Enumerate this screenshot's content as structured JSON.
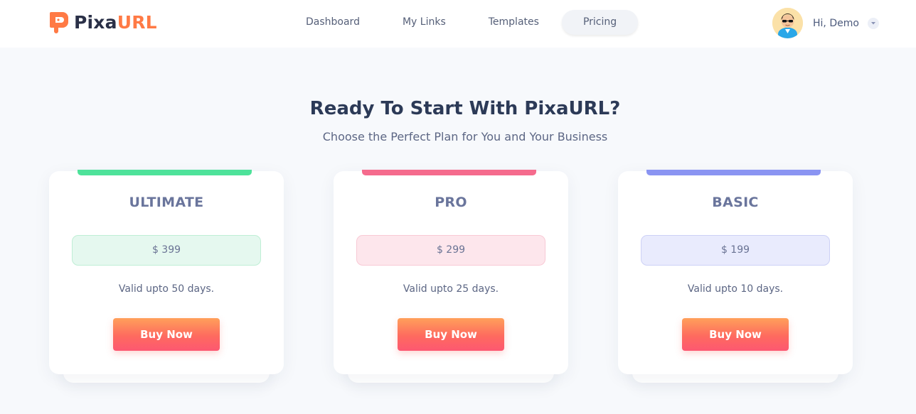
{
  "brand": {
    "name_part1": "Pixa",
    "name_part2": "URL",
    "accent_color": "#ff7a45"
  },
  "nav": {
    "items": [
      {
        "label": "Dashboard",
        "active": false
      },
      {
        "label": "My Links",
        "active": false
      },
      {
        "label": "Templates",
        "active": false
      },
      {
        "label": "Pricing",
        "active": true
      }
    ]
  },
  "user": {
    "greeting": "Hi, Demo",
    "avatar_icon": "avatar-icon",
    "menu_icon": "caret-down-icon"
  },
  "hero": {
    "title": "Ready To Start With PixaURL?",
    "subtitle": "Choose the Perfect Plan for You and Your Business"
  },
  "plans": [
    {
      "name": "ULTIMATE",
      "price": "$ 399",
      "validity": "Valid upto 50 days.",
      "button": "Buy Now",
      "accent": "#4ee29a",
      "price_bg": "#e5f8ef",
      "price_border": "#bfeed5"
    },
    {
      "name": "PRO",
      "price": "$ 299",
      "validity": "Valid upto 25 days.",
      "button": "Buy Now",
      "accent": "#f56b8d",
      "price_bg": "#fde6ec",
      "price_border": "#f8c9d5"
    },
    {
      "name": "BASIC",
      "price": "$ 199",
      "validity": "Valid upto 10 days.",
      "button": "Buy Now",
      "accent": "#8a94f2",
      "price_bg": "#e9ebfd",
      "price_border": "#cdd1f6"
    }
  ]
}
